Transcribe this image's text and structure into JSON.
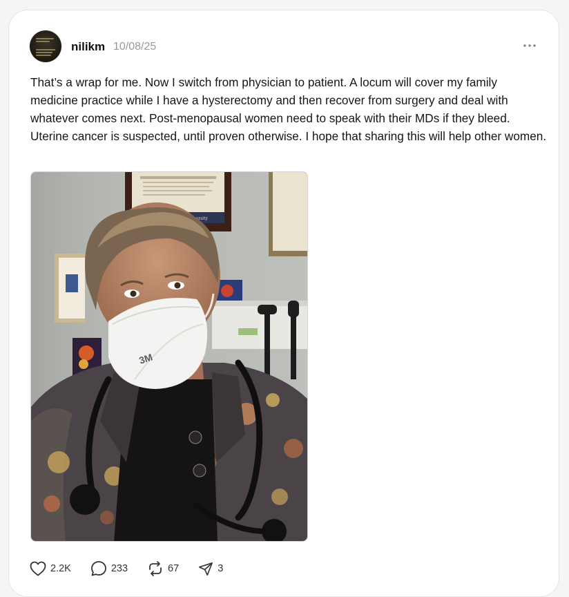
{
  "post": {
    "username": "nilikm",
    "date": "10/08/25",
    "text": "That’s a wrap for me. Now I switch from physician to patient. A locum will cover my family medicine practice while I have a hysterectomy and then recover from surgery and deal with whatever comes next. Post-menopausal women need to speak with their MDs if they bleed. Uterine cancer is suspected, until proven otherwise. I hope that sharing this will help other women.",
    "image_icon": "photo-selfie-masked-physician-stethoscope",
    "mask_text": "3M",
    "frame_text": "Yale University"
  },
  "actions": {
    "likes": "2.2K",
    "replies": "233",
    "reposts": "67",
    "shares": "3"
  },
  "icons": {
    "like": "heart-icon",
    "reply": "speech-bubble-icon",
    "repost": "repost-arrows-icon",
    "share": "paper-plane-icon",
    "more": "ellipsis-icon"
  }
}
